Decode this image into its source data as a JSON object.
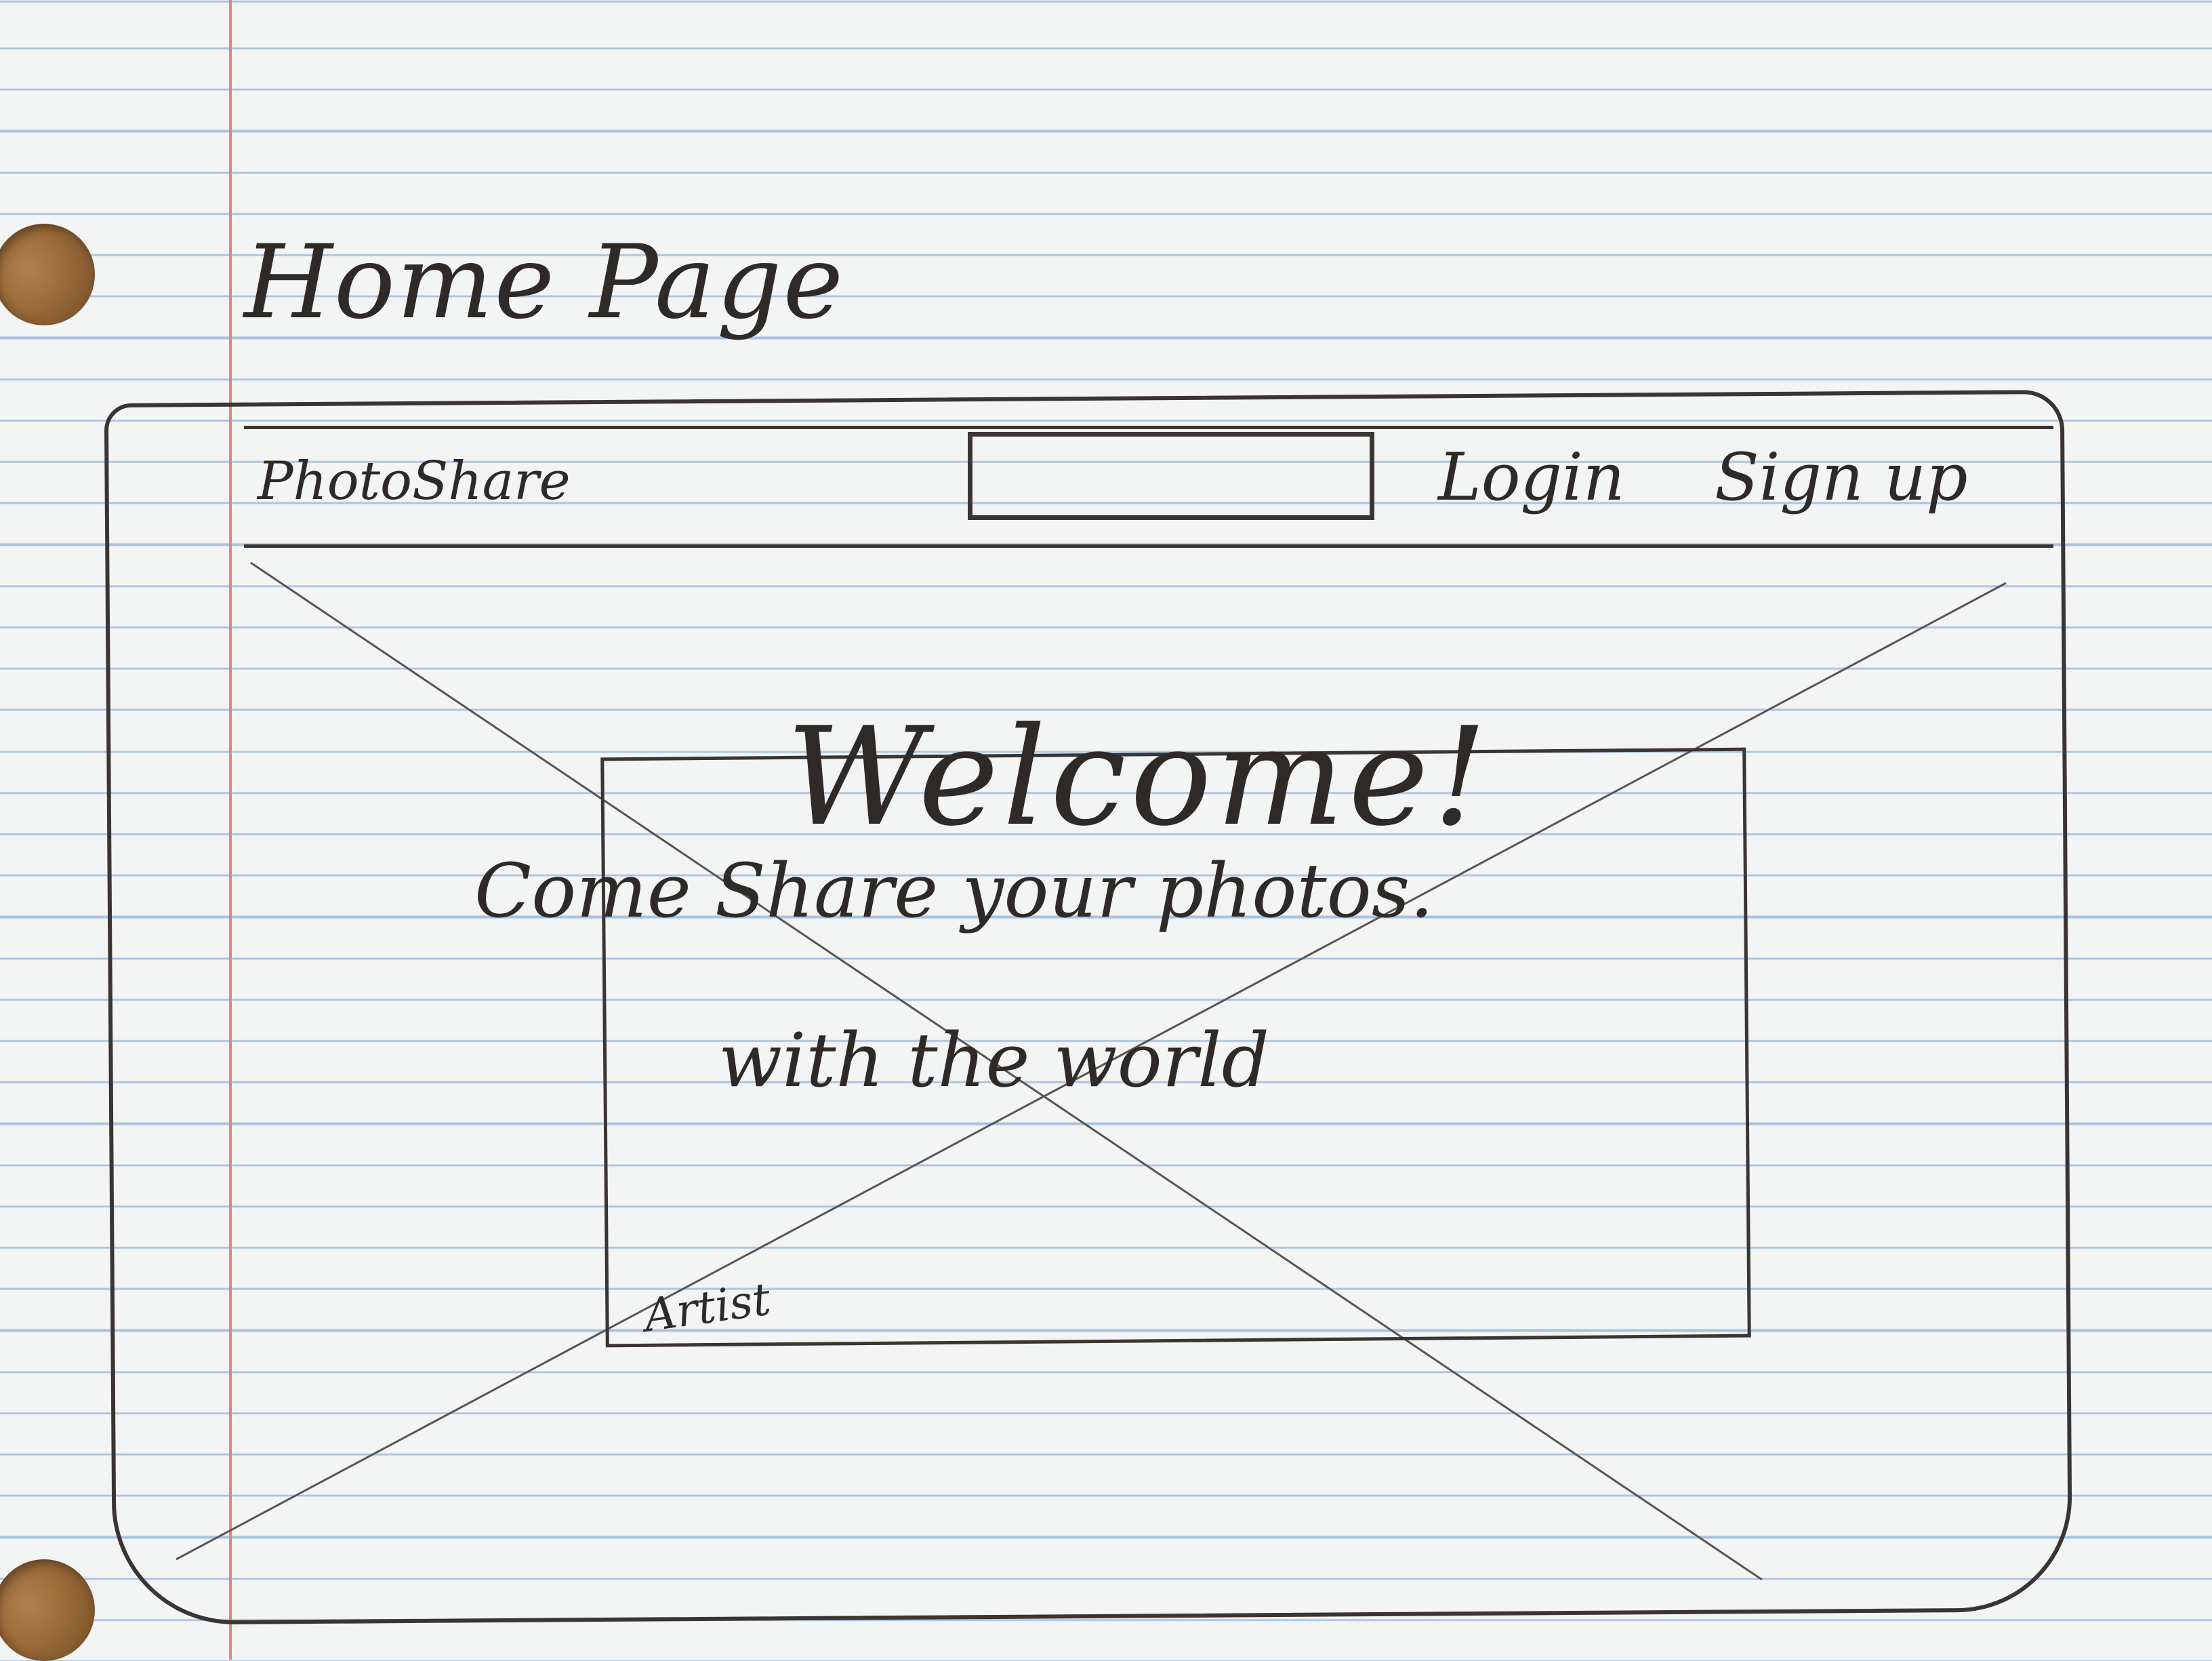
{
  "sketch": {
    "heading": "Home Page"
  },
  "nav": {
    "brand": "PhotoShare",
    "search": {
      "value": "",
      "placeholder": ""
    },
    "login_label": "Login",
    "signup_label": "Sign up"
  },
  "hero": {
    "title": "Welcome!",
    "tagline_line1": "Come Share your photos.",
    "tagline_line2": "with the world",
    "credit": "Artist"
  },
  "colors": {
    "ink": "#2e2a28",
    "paper": "#f3f4f4",
    "rule_line": "#a9c3df",
    "margin_line": "#ef7f73"
  }
}
